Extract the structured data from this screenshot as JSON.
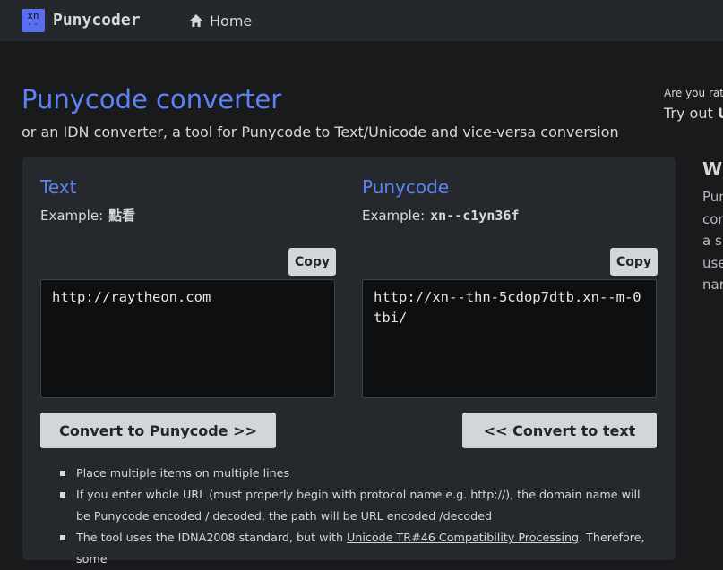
{
  "nav": {
    "logo_line1": "xn",
    "logo_line2": "--",
    "brand": "Punycoder",
    "home_label": "Home",
    "home_icon": "home-icon"
  },
  "header": {
    "title": "Punycode converter",
    "subtitle": "or an IDN converter, a tool for Punycode to Text/Unicode and vice-versa conversion"
  },
  "converter": {
    "text": {
      "title": "Text",
      "example_label": "Example:",
      "example_value": "點看",
      "copy_label": "Copy",
      "value": "http://raytheon.com",
      "button_label": "Convert to Punycode >>"
    },
    "punycode": {
      "title": "Punycode",
      "example_label": "Example:",
      "example_value": "xn--c1yn36f",
      "copy_label": "Copy",
      "value": "http://xn--thn-5cdop7dtb.xn--m-0tbi/",
      "button_label": "<< Convert to text"
    }
  },
  "notes": [
    {
      "text": "Place multiple items on multiple lines"
    },
    {
      "text": "If you enter whole URL (must properly begin with protocol name e.g. http://), the domain name will be Punycode encoded / decoded, the path will be URL encoded /decoded"
    },
    {
      "pre": "The tool uses the IDNA2008 standard, but with ",
      "link": "Unicode TR#46 Compatibility Processing",
      "post": ". Therefore, some"
    }
  ],
  "sidebar": {
    "promo_small": "Are you rat",
    "promo_pre": "Try out ",
    "promo_bold": "U",
    "heading": "Wh",
    "lines": [
      "Pun",
      "cor",
      "a s",
      "use",
      "nar"
    ]
  },
  "colors": {
    "accent": "#5e82f3",
    "background": "#181a1c",
    "nav": "#24272b",
    "panel": "#25282c",
    "button": "#d3d6d9"
  }
}
